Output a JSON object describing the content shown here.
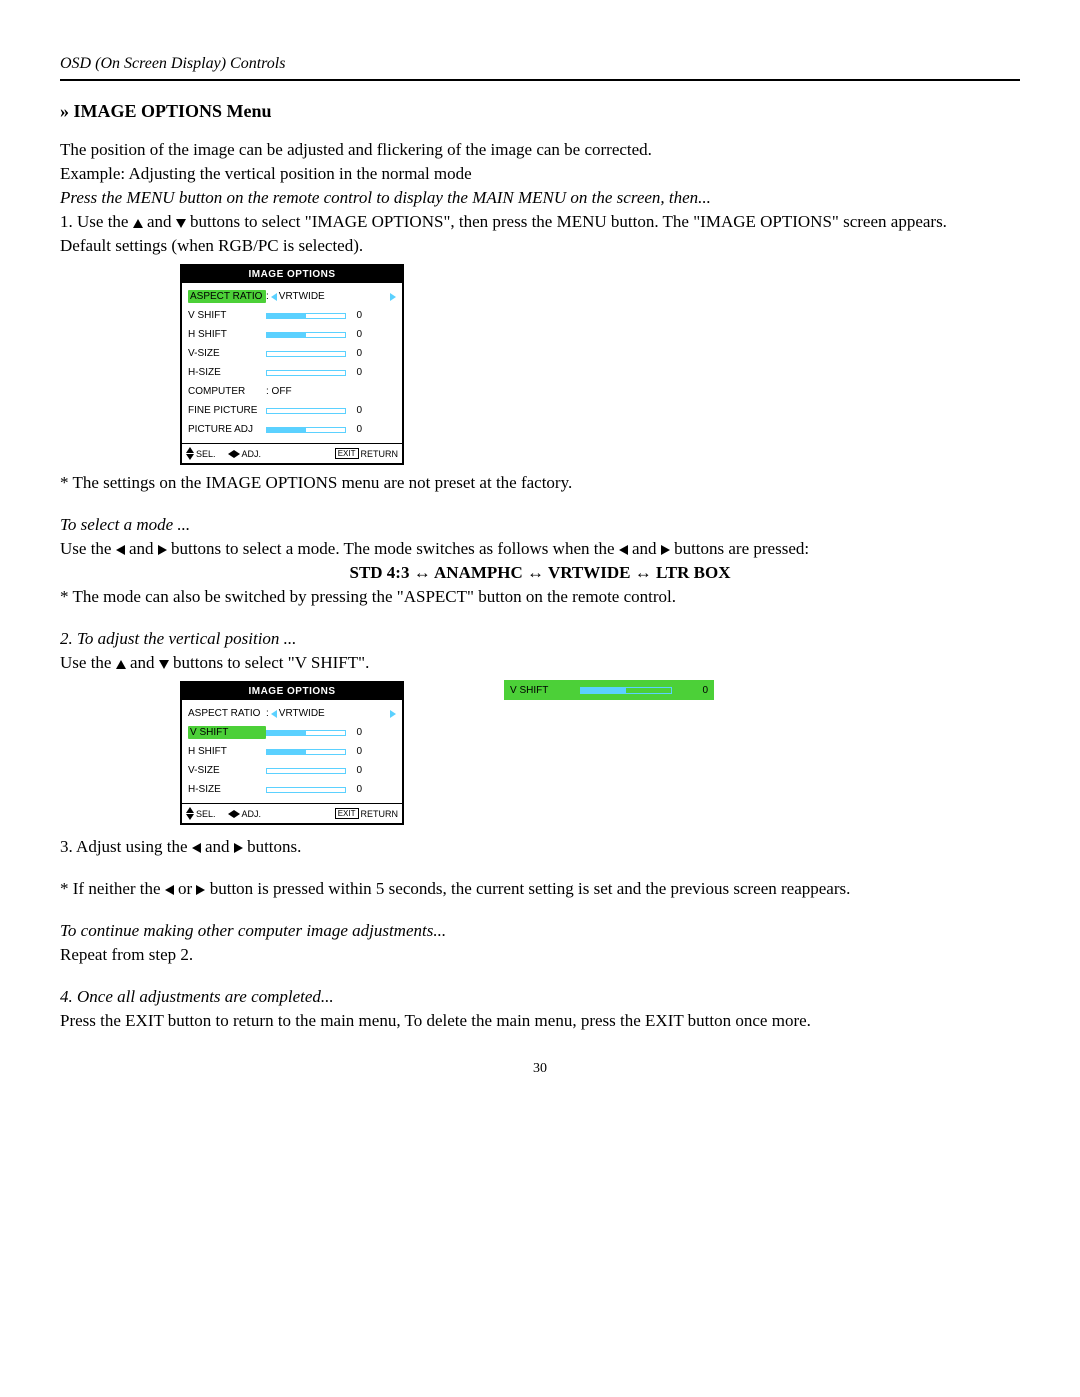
{
  "header": "OSD (On Screen Display) Controls",
  "title": "» IMAGE OPTIONS Menu",
  "p1": "The position of the image can be adjusted and flickering of the image can be corrected.",
  "p2": "Example: Adjusting the vertical position in the normal mode",
  "p3": "Press the MENU button on the remote control to display the MAIN MENU on the screen, then...",
  "p4a": "1. Use the ",
  "p4b": " and ",
  "p4c": " buttons to select \"IMAGE OPTIONS\", then press the MENU button. The \"IMAGE OPTIONS\" screen appears.",
  "p5": "Default settings (when RGB/PC is selected).",
  "osd1": {
    "title": "IMAGE OPTIONS",
    "rows": [
      {
        "label": "ASPECT RATIO",
        "type": "select",
        "value": "VRTWIDE",
        "selected": true
      },
      {
        "label": "V SHIFT",
        "type": "slider-half",
        "value": "0"
      },
      {
        "label": "H SHIFT",
        "type": "slider-half",
        "value": "0"
      },
      {
        "label": "V-SIZE",
        "type": "slider-empty",
        "value": "0"
      },
      {
        "label": "H-SIZE",
        "type": "slider-empty",
        "value": "0"
      },
      {
        "label": "COMPUTER",
        "type": "text",
        "value": ": OFF"
      },
      {
        "label": "FINE PICTURE",
        "type": "slider-empty",
        "value": "0"
      },
      {
        "label": "PICTURE ADJ",
        "type": "slider-half",
        "value": "0"
      }
    ],
    "footer": {
      "sel": "SEL.",
      "adj": "ADJ.",
      "exit": "EXIT",
      "ret": "RETURN"
    }
  },
  "p6": "* The settings on the IMAGE OPTIONS menu are not preset at the factory.",
  "p7": "To select a mode ...",
  "p8a": "Use the ",
  "p8b": " and ",
  "p8c": " buttons to select a mode. The mode switches as follows when the ",
  "p8d": " and ",
  "p8e": " buttons are pressed:",
  "modeseq": "STD 4:3 ↔ ANAMPHC ↔ VRTWIDE ↔ LTR BOX",
  "p9": "* The mode can also be switched by pressing the \"ASPECT\" button on the remote control.",
  "p10": "2. To adjust the vertical position ...",
  "p11a": "Use the ",
  "p11b": " and ",
  "p11c": " buttons to select \"V SHIFT\".",
  "osd2": {
    "title": "IMAGE OPTIONS",
    "rows": [
      {
        "label": "ASPECT RATIO",
        "type": "select",
        "value": "VRTWIDE"
      },
      {
        "label": "V SHIFT",
        "type": "slider-half",
        "value": "0",
        "selected": true
      },
      {
        "label": "H SHIFT",
        "type": "slider-half",
        "value": "0"
      },
      {
        "label": "V-SIZE",
        "type": "slider-empty",
        "value": "0"
      },
      {
        "label": "H-SIZE",
        "type": "slider-empty",
        "value": "0"
      }
    ],
    "footer": {
      "sel": "SEL.",
      "adj": "ADJ.",
      "exit": "EXIT",
      "ret": "RETURN"
    }
  },
  "adjbox": {
    "label": "V SHIFT",
    "value": "0"
  },
  "p12a": "3. Adjust using the ",
  "p12b": " and ",
  "p12c": " buttons.",
  "p13a": "* If neither the  ",
  "p13b": " or ",
  "p13c": " button is pressed within 5 seconds, the current setting is set and the previous screen reappears.",
  "p14": "To continue making other computer image adjustments...",
  "p15": "Repeat from step 2.",
  "p16": "4. Once all adjustments are completed...",
  "p17": "Press the EXIT button to return to the main menu, To delete the main menu, press the EXIT button once more.",
  "pagenum": "30"
}
